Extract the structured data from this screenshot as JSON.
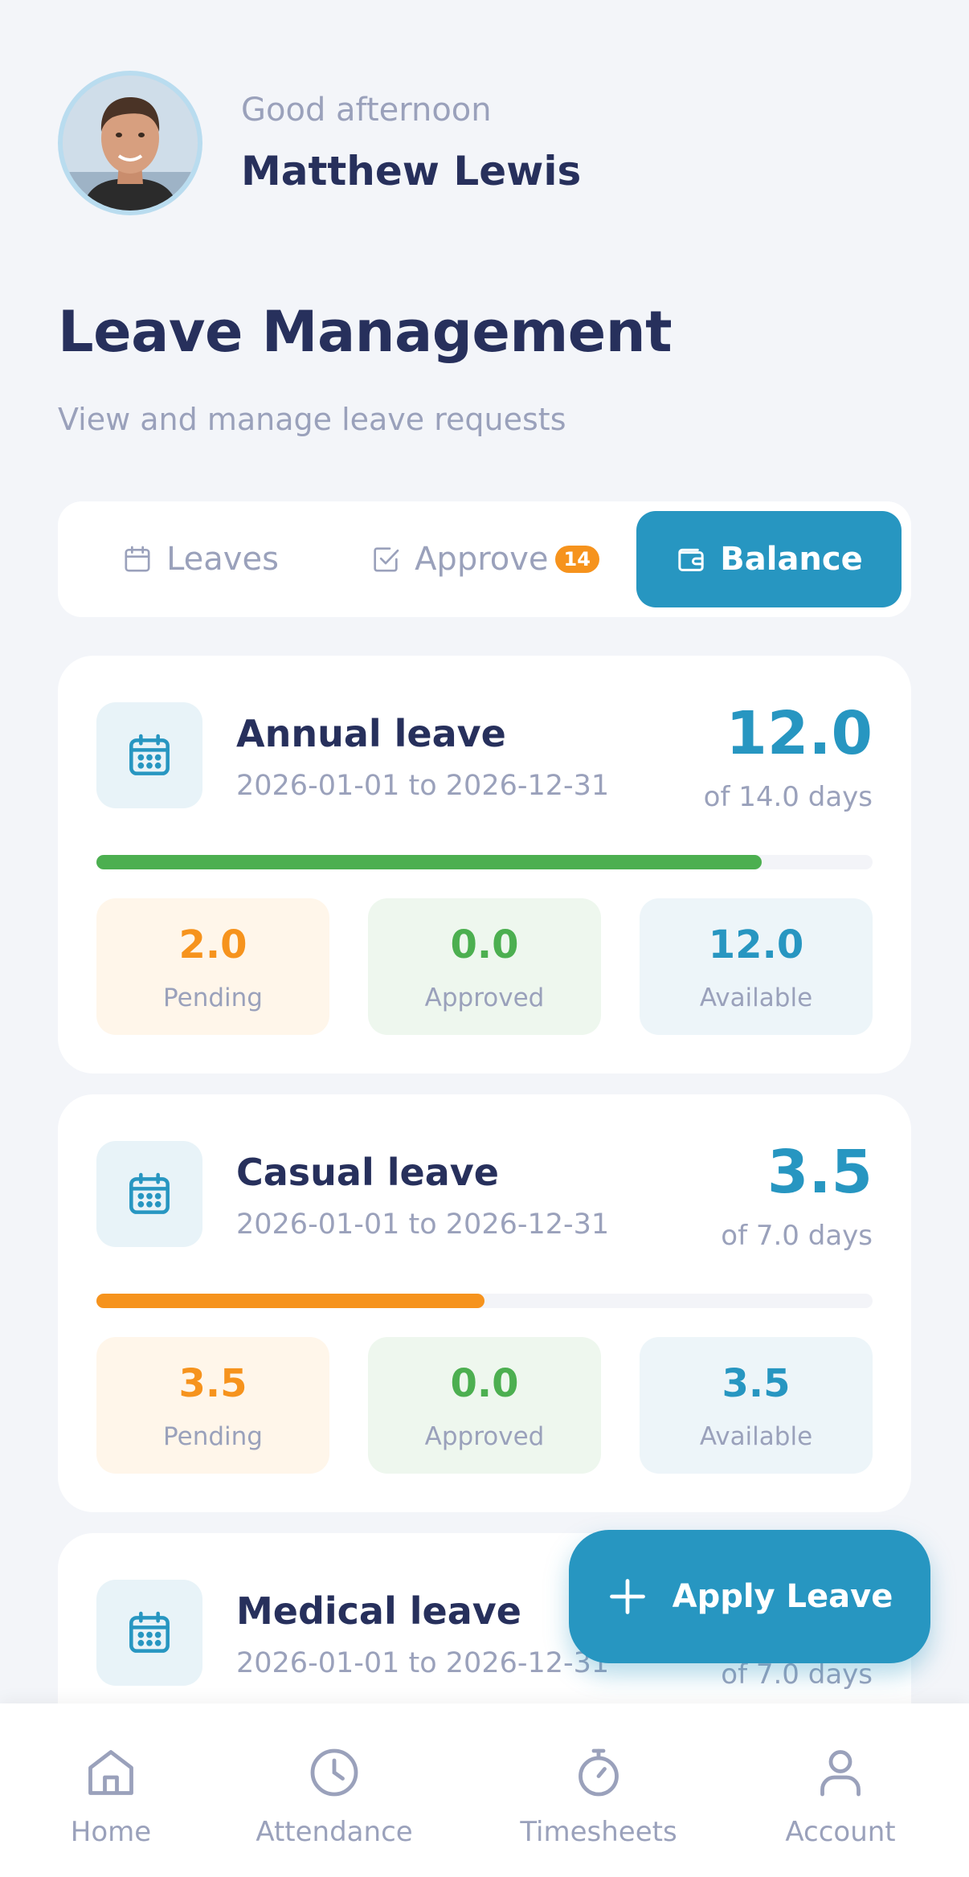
{
  "header": {
    "greeting": "Good afternoon",
    "user_name": "Matthew Lewis"
  },
  "page": {
    "title": "Leave Management",
    "subtitle": "View and manage leave requests"
  },
  "tabs": [
    {
      "label": "Leaves",
      "icon": "calendar-icon",
      "active": false
    },
    {
      "label": "Approve",
      "icon": "checkbox-icon",
      "badge": "14",
      "active": false
    },
    {
      "label": "Balance",
      "icon": "wallet-icon",
      "active": true
    }
  ],
  "leaves": [
    {
      "name": "Annual leave",
      "dates": "2026-01-01 to 2026-12-31",
      "available": "12.0",
      "total_label": "of 14.0 days",
      "progress": 0.857,
      "progress_color": "#4caf50",
      "stats": {
        "pending": "2.0",
        "approved": "0.0",
        "available": "12.0"
      }
    },
    {
      "name": "Casual leave",
      "dates": "2026-01-01 to 2026-12-31",
      "available": "3.5",
      "total_label": "of 7.0 days",
      "progress": 0.5,
      "progress_color": "#f6931d",
      "stats": {
        "pending": "3.5",
        "approved": "0.0",
        "available": "3.5"
      }
    },
    {
      "name": "Medical leave",
      "dates": "2026-01-01 to 2026-12-31",
      "total_label": "of 7.0 days"
    }
  ],
  "stat_labels": {
    "pending": "Pending",
    "approved": "Approved",
    "available": "Available"
  },
  "fab": {
    "label": "Apply Leave"
  },
  "bottom_nav": [
    {
      "label": "Home",
      "icon": "home-icon"
    },
    {
      "label": "Attendance",
      "icon": "clock-icon"
    },
    {
      "label": "Timesheets",
      "icon": "stopwatch-icon"
    },
    {
      "label": "Account",
      "icon": "user-icon"
    }
  ],
  "colors": {
    "accent": "#2796c1",
    "title": "#27305c",
    "muted": "#9aa1bb",
    "pending": "#f6931d",
    "approved": "#4caf50",
    "background": "#f3f5f9"
  }
}
